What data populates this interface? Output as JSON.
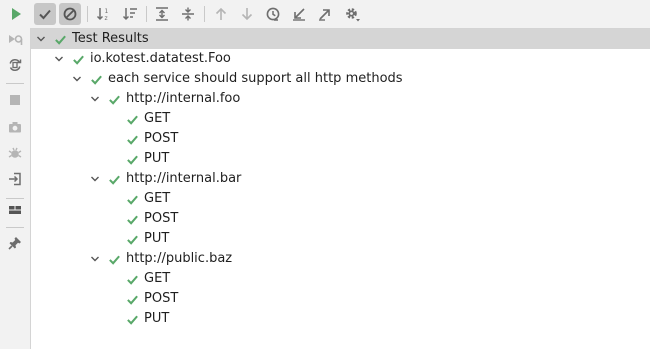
{
  "toolbar": {
    "buttons": [
      {
        "name": "rerun-icon",
        "label": "Rerun"
      },
      {
        "name": "show-passed-icon",
        "label": "Show Passed"
      },
      {
        "name": "show-ignored-icon",
        "label": "Show Ignored"
      },
      {
        "name": "sort-alphabetically-icon",
        "label": "Sort Alphabetically"
      },
      {
        "name": "sort-by-duration-icon",
        "label": "Sort by Duration"
      },
      {
        "name": "expand-all-icon",
        "label": "Expand All"
      },
      {
        "name": "collapse-all-icon",
        "label": "Collapse All"
      },
      {
        "name": "previous-failed-icon",
        "label": "Previous Failed Test"
      },
      {
        "name": "next-failed-icon",
        "label": "Next Failed Test"
      },
      {
        "name": "test-history-icon",
        "label": "Test History"
      },
      {
        "name": "import-tests-icon",
        "label": "Import Tests"
      },
      {
        "name": "export-tests-icon",
        "label": "Export Test Results"
      },
      {
        "name": "settings-icon",
        "label": "Settings"
      }
    ]
  },
  "sidebar": {
    "buttons": [
      {
        "name": "rerun-failed-icon"
      },
      {
        "name": "toggle-auto-test-icon"
      },
      {
        "name": "stop-icon"
      },
      {
        "name": "screenshot-icon"
      },
      {
        "name": "debug-icon"
      },
      {
        "name": "exit-icon"
      },
      {
        "name": "layout-icon"
      },
      {
        "name": "pin-icon"
      }
    ]
  },
  "tree": {
    "root": {
      "label": "Test Results",
      "status": "passed"
    },
    "nodes": [
      {
        "label": "io.kotest.datatest.Foo",
        "depth": 1,
        "expandable": true
      },
      {
        "label": "each service should support all http methods",
        "depth": 2,
        "expandable": true
      },
      {
        "label": "http://internal.foo",
        "depth": 3,
        "expandable": true
      },
      {
        "label": "GET",
        "depth": 4,
        "expandable": false
      },
      {
        "label": "POST",
        "depth": 4,
        "expandable": false
      },
      {
        "label": "PUT",
        "depth": 4,
        "expandable": false
      },
      {
        "label": "http://internal.bar",
        "depth": 3,
        "expandable": true
      },
      {
        "label": "GET",
        "depth": 4,
        "expandable": false
      },
      {
        "label": "POST",
        "depth": 4,
        "expandable": false
      },
      {
        "label": "PUT",
        "depth": 4,
        "expandable": false
      },
      {
        "label": "http://public.baz",
        "depth": 3,
        "expandable": true
      },
      {
        "label": "GET",
        "depth": 4,
        "expandable": false
      },
      {
        "label": "POST",
        "depth": 4,
        "expandable": false
      },
      {
        "label": "PUT",
        "depth": 4,
        "expandable": false
      }
    ]
  },
  "colors": {
    "pass": "#59a869",
    "icon": "#6e6e6e",
    "disabled": "#b5b5b5"
  }
}
